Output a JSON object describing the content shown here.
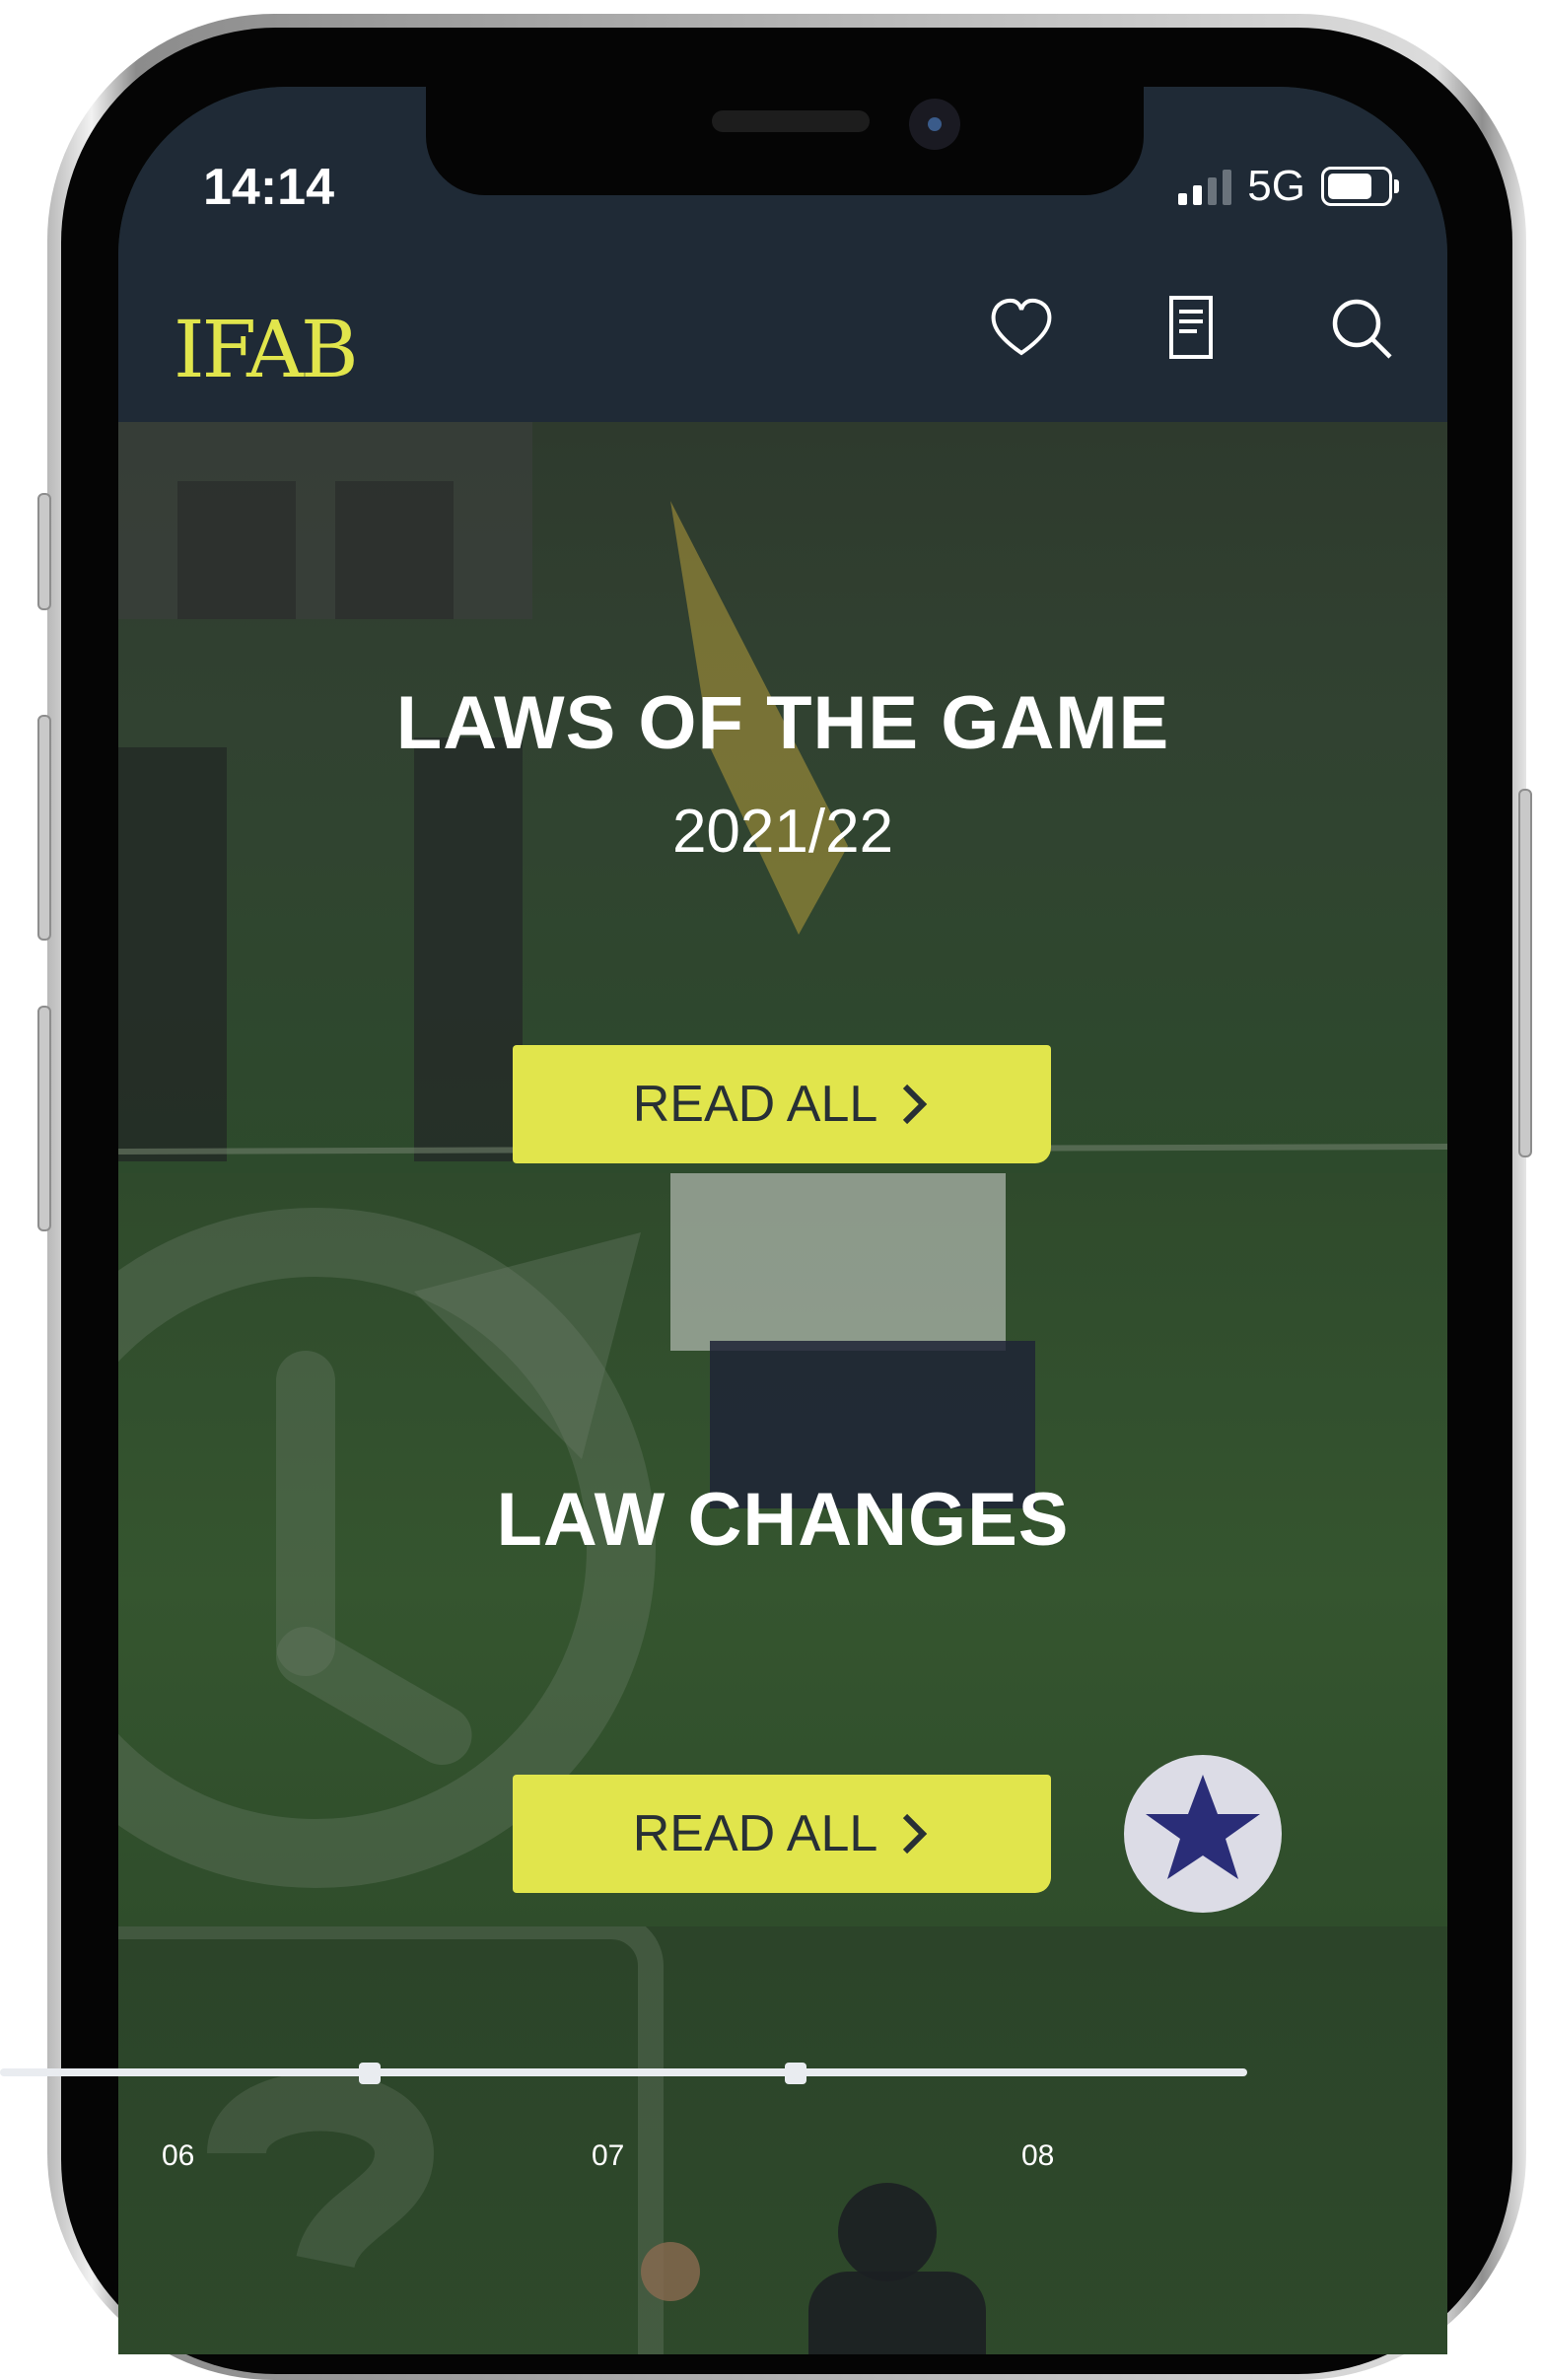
{
  "status_bar": {
    "time": "14:14",
    "network": "5G",
    "battery_level": 0.75
  },
  "header": {
    "logo": "IFAB",
    "brand_color": "#e1e54c",
    "icons": [
      "heart-icon",
      "document-icon",
      "search-icon"
    ]
  },
  "sections": [
    {
      "title": "LAWS OF THE GAME",
      "subtitle": "2021/22",
      "button_label": "READ ALL"
    },
    {
      "title": "LAW CHANGES",
      "button_label": "READ ALL"
    }
  ],
  "timeline": {
    "labels": [
      "06",
      "07",
      "08"
    ]
  }
}
